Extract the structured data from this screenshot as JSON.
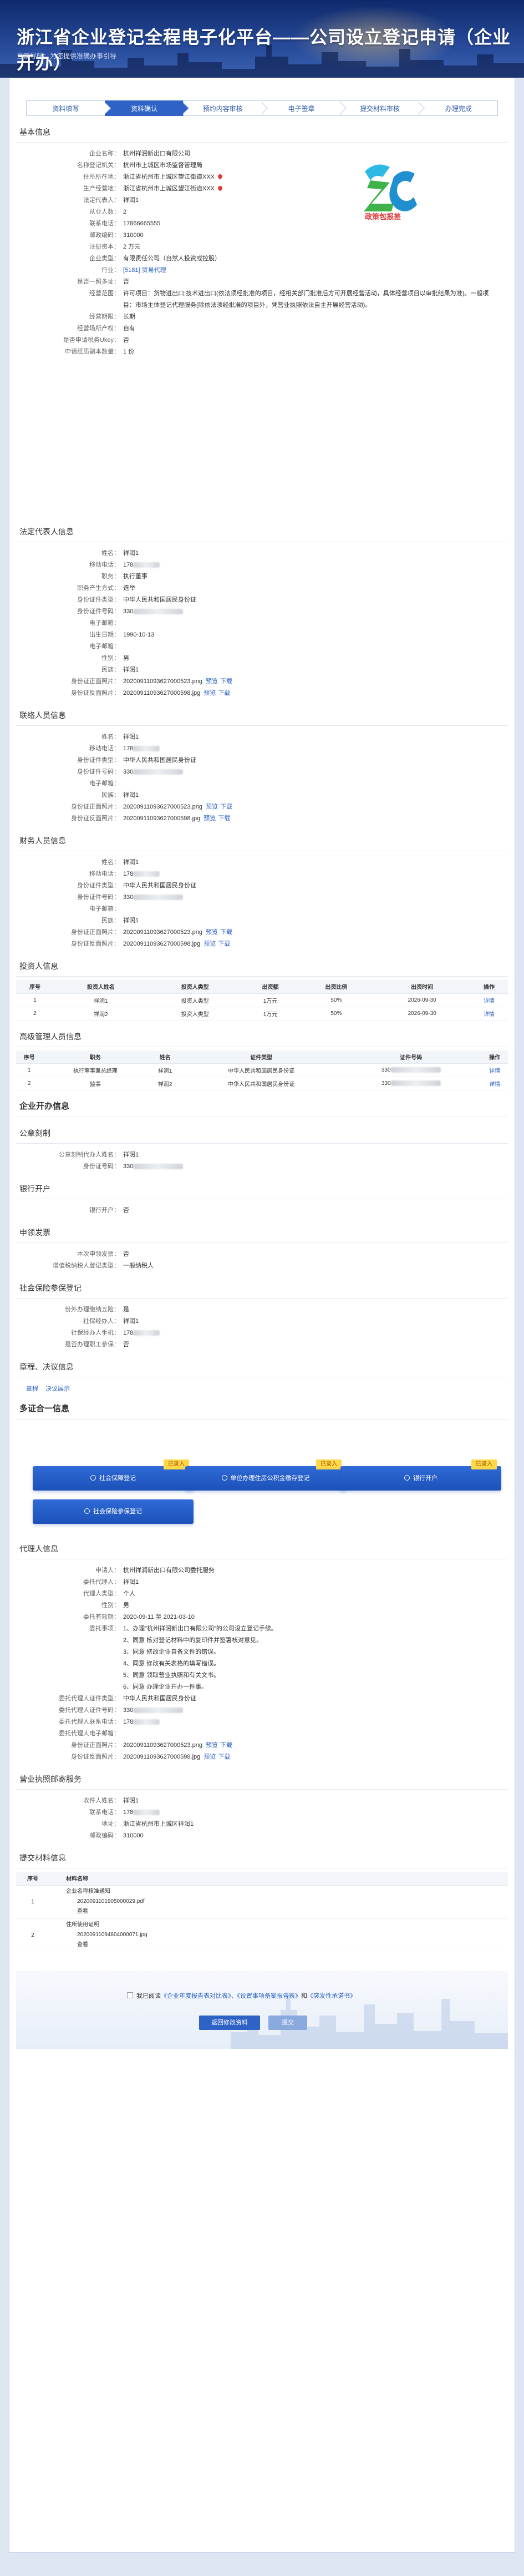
{
  "header": {
    "title": "浙江省企业登记全程电子化平台——公司设立登记申请（企业开办）",
    "subtitle": "当前导航：为您提供准确办事引导"
  },
  "steps": [
    {
      "label": "资料填写"
    },
    {
      "label": "资料确认"
    },
    {
      "label": "预约内容审核"
    },
    {
      "label": "电子签章"
    },
    {
      "label": "提交材料审核"
    },
    {
      "label": "办理完成"
    }
  ],
  "basic": {
    "title": "基本信息",
    "logo_text": "政策包报差",
    "rows": [
      {
        "label": "企业名称：",
        "value": "杭州祥润新出口有限公司"
      },
      {
        "label": "名称登记机关：",
        "value": "杭州市上城区市场监督管理局"
      },
      {
        "label": "住所所在地：",
        "value": "浙江省杭州市上城区望江街道XXX"
      },
      {
        "label": "生产经营地：",
        "value": "浙江省杭州市上城区望江街道XXX"
      },
      {
        "label": "法定代表人：",
        "value": "祥润1"
      },
      {
        "label": "从业人数：",
        "value": "2"
      },
      {
        "label": "联系电话：",
        "value": "17866665555"
      },
      {
        "label": "邮政编码：",
        "value": "310000"
      },
      {
        "label": "注册资本：",
        "value": "2 万元"
      },
      {
        "label": "企业类型：",
        "value": "有限责任公司（自然人投资或控股）"
      },
      {
        "label": "行业：",
        "value": "[5181] 贸易代理"
      },
      {
        "label": "是否一照多址：",
        "value": "否"
      },
      {
        "label": "经营范围：",
        "value": "许可项目：货物进出口;技术进出口(依法须经批准的项目，经相关部门批准后方可开展经营活动，具体经营项目以审批结果为准)。一般项目：市场主体登记代理服务(除依法须经批准的项目外，凭营业执照依法自主开展经营活动)。"
      },
      {
        "label": "经营期限：",
        "value": "长期"
      },
      {
        "label": "经营场所产权：",
        "value": "自有"
      },
      {
        "label": "是否申请税务Ukey：",
        "value": "否"
      },
      {
        "label": "申请纸质副本数量：",
        "value": "1 份"
      }
    ]
  },
  "legal_rep": {
    "title": "法定代表人信息",
    "rows": [
      {
        "label": "姓名：",
        "value": "祥润1"
      },
      {
        "label": "移动电话：",
        "value": "178"
      },
      {
        "label": "职务：",
        "value": "执行董事"
      },
      {
        "label": "职务产生方式：",
        "value": "选举"
      },
      {
        "label": "身份证件类型：",
        "value": "中华人民共和国居民身份证"
      },
      {
        "label": "身份证件号码：",
        "value": "330"
      },
      {
        "label": "电子邮箱：",
        "value": ""
      },
      {
        "label": "出生日期：",
        "value": "1990-10-13"
      },
      {
        "label": "电子邮箱：",
        "value": ""
      },
      {
        "label": "性别：",
        "value": "男"
      },
      {
        "label": "民族：",
        "value": "祥润1"
      },
      {
        "label": "身份证正面照片：",
        "value": "20200911093627000523.png"
      },
      {
        "label": "身份证反面照片：",
        "value": "20200911093627000598.jpg"
      }
    ]
  },
  "contact": {
    "title": "联络人员信息",
    "rows": [
      {
        "label": "姓名：",
        "value": "祥润1"
      },
      {
        "label": "移动电话：",
        "value": "178"
      },
      {
        "label": "身份证件类型：",
        "value": "中华人民共和国居民身份证"
      },
      {
        "label": "身份证件号码：",
        "value": "330"
      },
      {
        "label": "电子邮箱：",
        "value": ""
      },
      {
        "label": "民族：",
        "value": "祥润1"
      },
      {
        "label": "身份证正面照片：",
        "value": "20200911093627000523.png"
      },
      {
        "label": "身份证反面照片：",
        "value": "20200911093627000598.jpg"
      }
    ]
  },
  "finance": {
    "title": "财务人员信息",
    "rows": [
      {
        "label": "姓名：",
        "value": "祥润1"
      },
      {
        "label": "移动电话：",
        "value": "178"
      },
      {
        "label": "身份证件类型：",
        "value": "中华人民共和国居民身份证"
      },
      {
        "label": "身份证件号码：",
        "value": "330"
      },
      {
        "label": "电子邮箱：",
        "value": ""
      },
      {
        "label": "民族：",
        "value": "祥润1"
      },
      {
        "label": "身份证正面照片：",
        "value": "20200911093627000523.png"
      },
      {
        "label": "身份证反面照片：",
        "value": "20200911093627000598.jpg"
      }
    ]
  },
  "actions": {
    "preview": "预览",
    "download": "下载"
  },
  "investors": {
    "title": "投资人信息",
    "headers": [
      "序号",
      "投资人姓名",
      "投资人类型",
      "出资额",
      "出资比例",
      "出资时间",
      "操作"
    ],
    "rows": [
      [
        "1",
        "祥润1",
        "投资人类型",
        "1万元",
        "50%",
        "2026-09-30",
        "详情"
      ],
      [
        "2",
        "祥润2",
        "投资人类型",
        "1万元",
        "50%",
        "2026-09-30",
        "详情"
      ]
    ]
  },
  "managers": {
    "title": "高级管理人员信息",
    "headers": [
      "序号",
      "职务",
      "姓名",
      "证件类型",
      "证件号码",
      "操作"
    ],
    "rows": [
      [
        "1",
        "执行董事兼总经理",
        "祥润1",
        "中华人民共和国居民身份证",
        "330",
        "详情"
      ],
      [
        "2",
        "监事",
        "祥润2",
        "中华人民共和国居民身份证",
        "330",
        "详情"
      ]
    ]
  },
  "kaiban": {
    "title": "企业开办信息"
  },
  "seal": {
    "title": "公章刻制",
    "rows": [
      {
        "label": "公章刻制代办人姓名：",
        "value": "祥润1"
      },
      {
        "label": "身份证号码：",
        "value": "330"
      }
    ]
  },
  "bank": {
    "title": "银行开户",
    "rows": [
      {
        "label": "银行开户：",
        "value": "否"
      }
    ]
  },
  "invoice": {
    "title": "申领发票",
    "rows": [
      {
        "label": "本次申领发票：",
        "value": "否"
      },
      {
        "label": "增值税纳税人登记类型：",
        "value": "一般纳税人"
      }
    ]
  },
  "social": {
    "title": "社会保险参保登记",
    "rows": [
      {
        "label": "份外办理缴纳五险：",
        "value": "是"
      },
      {
        "label": "社保经办人：",
        "value": "祥润1"
      },
      {
        "label": "社保经办人手机：",
        "value": "178"
      },
      {
        "label": "是否办理职工参保：",
        "value": "否"
      }
    ]
  },
  "charter": {
    "title": "章程、决议信息",
    "links": [
      "章程",
      "决议展示"
    ]
  },
  "multi_cert": {
    "title": "多证合一信息",
    "tag": "已录入",
    "items": [
      "社会保障登记",
      "单位办理住房公积金缴存登记",
      "银行开户",
      "社会保险参保登记"
    ]
  },
  "agent": {
    "title": "代理人信息",
    "rows": [
      {
        "label": "申请人：",
        "value": "杭州祥润新出口有限公司委托服务"
      },
      {
        "label": "委托代理人：",
        "value": "祥润1"
      },
      {
        "label": "代理人类型：",
        "value": "个人"
      },
      {
        "label": "性别：",
        "value": "男"
      },
      {
        "label": "委托有效期：",
        "value": "2020-09-11 至 2021-03-10"
      }
    ],
    "entrust_label": "委托事项：",
    "entrust_items": [
      "1、办理\"杭州祥润新出口有限公司\"的公司设立登记手续。",
      "2、同意 核对登记材料中的复印件并签署核对意见。",
      "3、同意 修改企业自备文件的错误。",
      "4、同意 修改有关表格的填写错误。",
      "5、同意 领取营业执照和有关文书。",
      "6、同意 办理企业开办一件事。"
    ],
    "rows2": [
      {
        "label": "委托代理人证件类型：",
        "value": "中华人民共和国居民身份证"
      },
      {
        "label": "委托代理人证件号码：",
        "value": "330"
      },
      {
        "label": "委托代理人联系电话：",
        "value": "178"
      },
      {
        "label": "委托代理人电子邮箱：",
        "value": ""
      },
      {
        "label": "身份证正面照片：",
        "value": "20200911093627000523.png"
      },
      {
        "label": "身份证反面照片：",
        "value": "20200911093627000598.jpg"
      }
    ]
  },
  "license": {
    "title": "营业执照邮寄服务",
    "rows": [
      {
        "label": "收件人姓名：",
        "value": "祥润1"
      },
      {
        "label": "联系电话：",
        "value": "178"
      },
      {
        "label": "地址：",
        "value": "浙江省杭州市上城区祥润1"
      },
      {
        "label": "邮政编码：",
        "value": "310000"
      }
    ]
  },
  "materials": {
    "title": "提交材料信息",
    "headers": [
      "序号",
      "材料名称"
    ],
    "rows": [
      {
        "no": "1",
        "name": "企业名称核准通知",
        "file": "2020091101905000029.pdf",
        "op": "查看"
      },
      {
        "no": "2",
        "name": "住所使用证明",
        "file": "20200911094804000071.jpg",
        "op": "查看"
      }
    ]
  },
  "footer": {
    "agree_prefix": "我已阅读",
    "doc1": "《企业年度报告表对比表》",
    "sep": "、",
    "doc2": "《设置事项备案报告表》",
    "and": "和",
    "doc3": "《突发性承诺书》",
    "btn_back": "返回修改资料",
    "btn_next": "提交"
  },
  "colors": {
    "accent": "#2e63c5",
    "header": "#1b3a85",
    "tag": "#ffd84a"
  }
}
